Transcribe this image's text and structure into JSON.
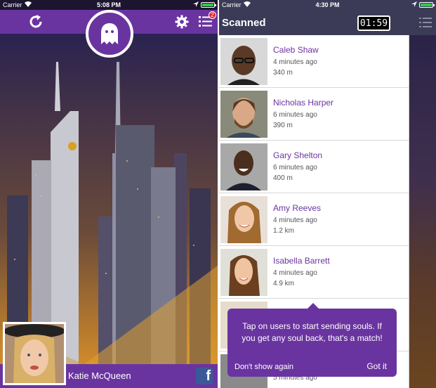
{
  "left": {
    "status": {
      "carrier": "Carrier",
      "time": "5:08 PM"
    },
    "header": {
      "notification_count": "2"
    },
    "profile": {
      "name": "Katie McQueen"
    },
    "facebook_label": "f"
  },
  "right": {
    "status": {
      "carrier": "Carrier",
      "time": "4:30 PM"
    },
    "header": {
      "title": "Scanned",
      "timer": "01:59"
    },
    "users": [
      {
        "name": "Caleb Shaw",
        "ago": "4 minutes ago",
        "distance": "340 m"
      },
      {
        "name": "Nicholas Harper",
        "ago": "6 minutes ago",
        "distance": "390 m"
      },
      {
        "name": "Gary Shelton",
        "ago": "6 minutes ago",
        "distance": "400 m"
      },
      {
        "name": "Amy Reeves",
        "ago": "4 minutes ago",
        "distance": "1.2 km"
      },
      {
        "name": "Isabella Barrett",
        "ago": "4 minutes ago",
        "distance": "4.9 km"
      },
      {
        "name": "",
        "ago": "",
        "distance": ""
      },
      {
        "name": "",
        "ago": "5 minutes ago",
        "distance": ""
      }
    ],
    "tooltip": {
      "message": "Tap on users to start sending souls. If you get any soul back, that's a match!",
      "dismiss": "Don't show again",
      "confirm": "Got it"
    }
  },
  "colors": {
    "purple": "#6a34a0",
    "navy_header": "#3b3b58",
    "facebook": "#3b5998",
    "badge_red": "#e3262e"
  }
}
